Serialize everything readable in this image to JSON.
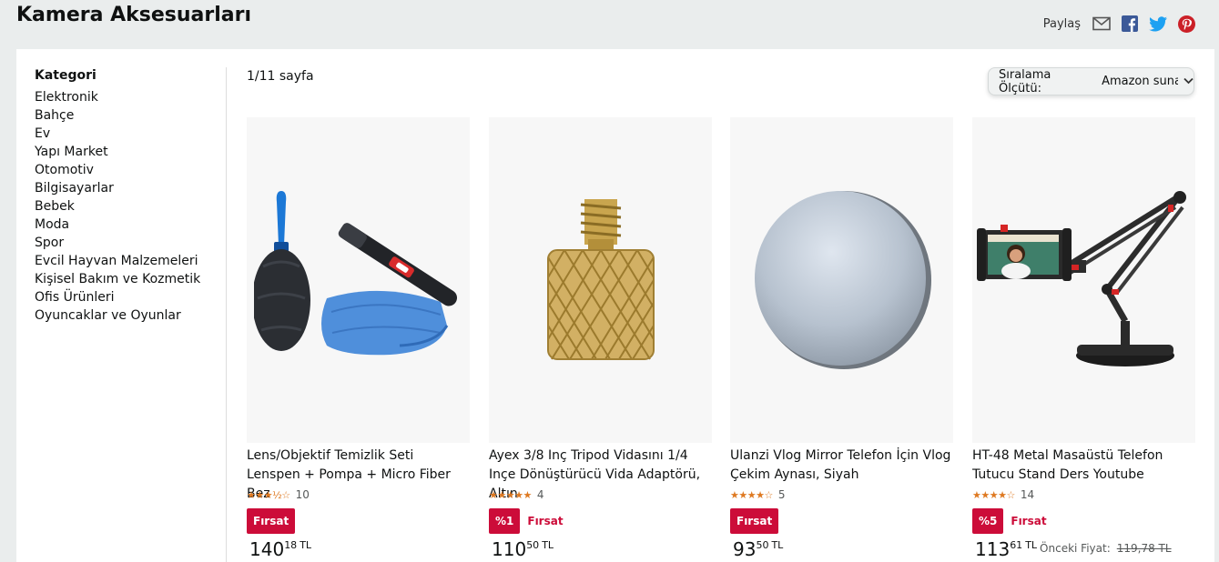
{
  "header": {
    "title": "Kamera Aksesuarları"
  },
  "share": {
    "label": "Paylaş",
    "icons": [
      "mail-icon",
      "facebook-icon",
      "twitter-icon",
      "pinterest-icon"
    ]
  },
  "sidebar": {
    "heading": "Kategori",
    "items": [
      {
        "label": "Elektronik"
      },
      {
        "label": "Bahçe"
      },
      {
        "label": "Ev"
      },
      {
        "label": "Yapı Market"
      },
      {
        "label": "Otomotiv"
      },
      {
        "label": "Bilgisayarlar"
      },
      {
        "label": "Bebek"
      },
      {
        "label": "Moda"
      },
      {
        "label": "Spor"
      },
      {
        "label": "Evcil Hayvan Malzemeleri"
      },
      {
        "label": "Kişisel Bakım ve Kozmetik"
      },
      {
        "label": "Ofis Ürünleri"
      },
      {
        "label": "Oyuncaklar ve Oyunlar"
      }
    ]
  },
  "results": {
    "page_info": "1/11 sayfa"
  },
  "sort": {
    "label": "Sıralama Ölçütü:",
    "value": "Amazon sunar"
  },
  "colors": {
    "deal_red": "#cc0c39",
    "star_orange": "#de7921",
    "background": "#eaeded"
  },
  "products": [
    {
      "title": "Lens/Objektif Temizlik Seti Lenspen + Pompa + Micro Fiber Bez",
      "stars": "★★★½☆",
      "rating": 3.5,
      "rating_count": "10",
      "badge": "Fırsat",
      "deal_text": "",
      "price_whole": "140",
      "price_fraction": "18",
      "currency": "TL",
      "previous_label": "",
      "previous_price": "",
      "image": "lens-cleaning-kit-image"
    },
    {
      "title": "Ayex 3/8 Inç Tripod Vidasını 1/4 Inçe Dönüştürücü Vida Adaptörü, Altın",
      "stars": "★★★★★",
      "rating": 5,
      "rating_count": "4",
      "badge": "%1",
      "deal_text": "Fırsat",
      "price_whole": "110",
      "price_fraction": "50",
      "currency": "TL",
      "previous_label": "",
      "previous_price": "",
      "image": "screw-adapter-image"
    },
    {
      "title": "Ulanzi Vlog Mirror Telefon İçin Vlog Çekim Aynası, Siyah",
      "stars": "★★★★☆",
      "rating": 4,
      "rating_count": "5",
      "badge": "Fırsat",
      "deal_text": "",
      "price_whole": "93",
      "price_fraction": "50",
      "currency": "TL",
      "previous_label": "",
      "previous_price": "",
      "image": "vlog-mirror-image"
    },
    {
      "title": "HT-48 Metal Masaüstü Telefon Tutucu Stand Ders Youtube",
      "stars": "★★★★☆",
      "rating": 4,
      "rating_count": "14",
      "badge": "%5",
      "deal_text": "Fırsat",
      "price_whole": "113",
      "price_fraction": "61",
      "currency": "TL",
      "previous_label": "Önceki Fiyat:",
      "previous_price": "119,78 TL",
      "image": "phone-stand-image"
    }
  ]
}
